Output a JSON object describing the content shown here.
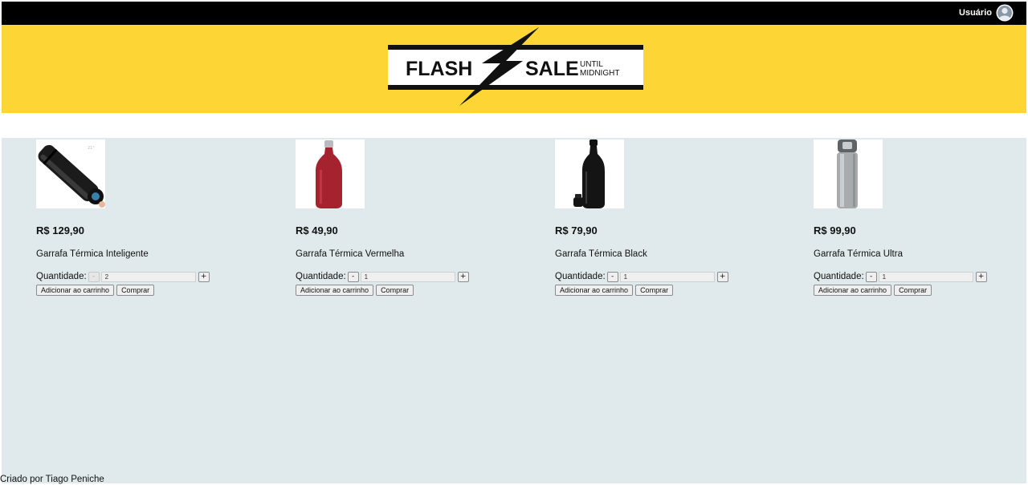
{
  "header": {
    "user_label": "Usuário",
    "avatar_icon": "user-avatar-icon"
  },
  "banner": {
    "word_left": "FLASH",
    "word_right": "SALE",
    "until": "UNTIL",
    "midnight": "MIDNIGHT",
    "bg_color": "#fdd535"
  },
  "products": [
    {
      "price": "R$ 129,90",
      "name": "Garrafa Térmica Inteligente",
      "qty_label": "Quantidade:",
      "minus": "-",
      "plus": "+",
      "qty_value": "2",
      "add_to_cart": "Adicionar ao carrinho",
      "buy": "Comprar",
      "image": "smart-thermal-bottle"
    },
    {
      "price": "R$ 49,90",
      "name": "Garrafa Térmica Vermelha",
      "qty_label": "Quantidade:",
      "minus": "-",
      "plus": "+",
      "qty_value": "1",
      "add_to_cart": "Adicionar ao carrinho",
      "buy": "Comprar",
      "image": "red-thermal-bottle"
    },
    {
      "price": "R$ 79,90",
      "name": "Garrafa Térmica Black",
      "qty_label": "Quantidade:",
      "minus": "-",
      "plus": "+",
      "qty_value": "1",
      "add_to_cart": "Adicionar ao carrinho",
      "buy": "Comprar",
      "image": "black-thermal-bottle"
    },
    {
      "price": "R$ 99,90",
      "name": "Garrafa Térmica Ultra",
      "qty_label": "Quantidade:",
      "minus": "-",
      "plus": "+",
      "qty_value": "1",
      "add_to_cart": "Adicionar ao carrinho",
      "buy": "Comprar",
      "image": "silver-thermal-bottle"
    }
  ],
  "footer": {
    "text": "Criado por Tiago Peniche"
  },
  "colors": {
    "topbar": "#000000",
    "banner": "#fdd535",
    "content_bg": "#e0e9eb"
  }
}
